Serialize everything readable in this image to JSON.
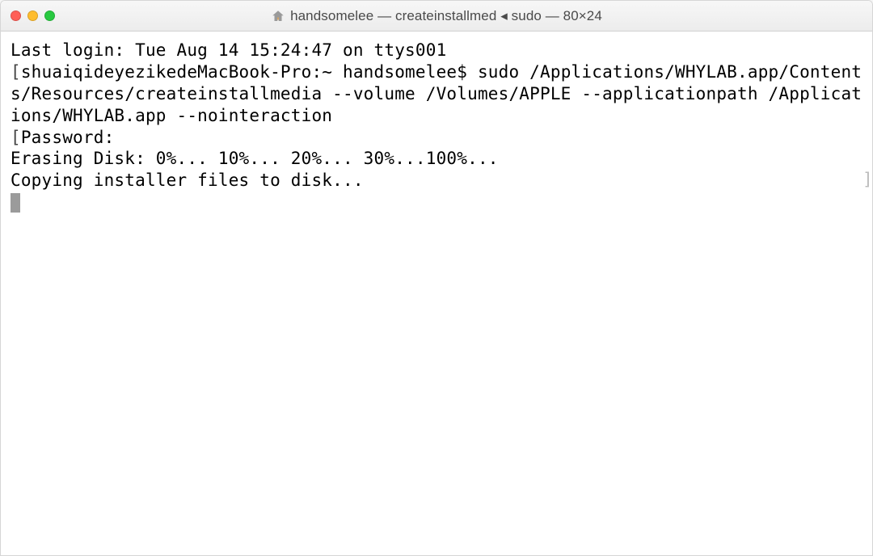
{
  "window": {
    "title": "handsomelee — createinstallmed ◂ sudo — 80×24"
  },
  "terminal": {
    "lines": {
      "last_login": "Last login: Tue Aug 14 15:24:47 on ttys001",
      "prompt_open": "[",
      "prompt_host": "shuaiqideyezikedeMacBook-Pro:~ handsomelee$ ",
      "command": "sudo /Applications/WHYLAB.app/Contents/Resources/createinstallmedia --volume /Volumes/APPLE --applicationpath /Applications/WHYLAB.app --nointeraction",
      "prompt_close_wrap1": "]",
      "password": "Password:",
      "erasing": "Erasing Disk: 0%... 10%... 20%... 30%...100%...",
      "copying": "Copying installer files to disk..."
    }
  }
}
